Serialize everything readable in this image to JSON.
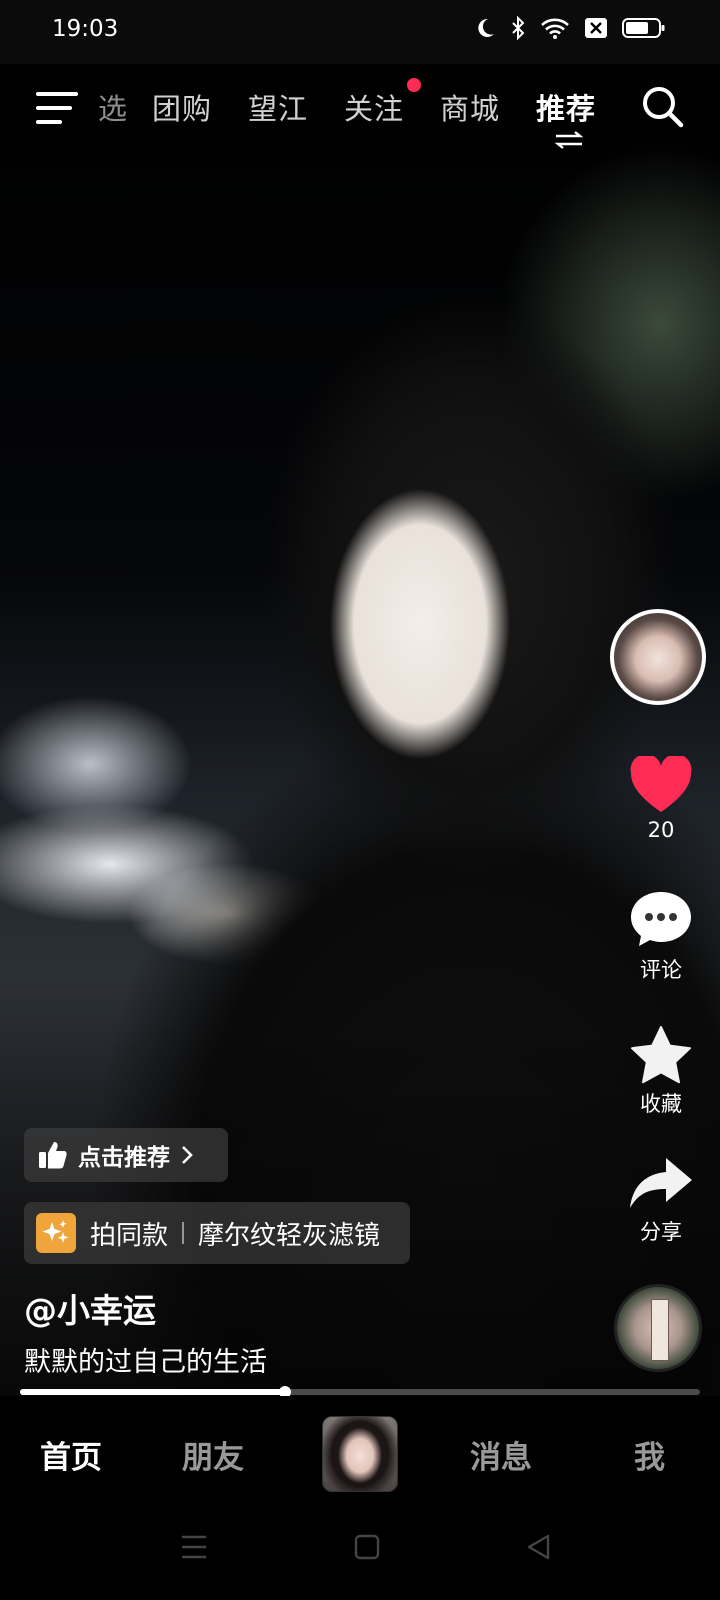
{
  "status_bar": {
    "time": "19:03"
  },
  "top_nav": {
    "tabs": [
      "选",
      "团购",
      "望江",
      "关注",
      "商城",
      "推荐"
    ],
    "active_tab": "推荐"
  },
  "rail": {
    "like_count": "20",
    "comment_label": "评论",
    "favorite_label": "收藏",
    "share_label": "分享"
  },
  "video": {
    "recommend_label": "点击推荐",
    "filter_action": "拍同款",
    "filter_name": "摩尔纹轻灰滤镜",
    "author": "@小幸运",
    "caption": "默默的过自己的生活",
    "progress": 0.39
  },
  "tabbar": {
    "home": "首页",
    "friends": "朋友",
    "messages": "消息",
    "me": "我"
  },
  "colors": {
    "accent_red": "#fe2c55",
    "filter_badge": "#f0a53b"
  }
}
